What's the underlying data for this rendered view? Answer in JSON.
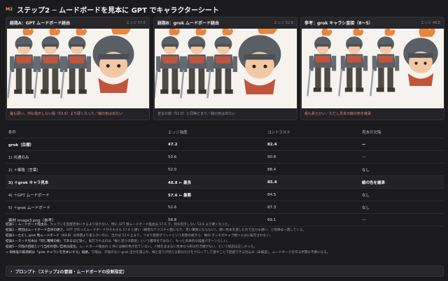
{
  "header": {
    "badge": "M2",
    "title": "ステップ2 ─ ムードボードを見本に GPT でキャラクターシート"
  },
  "colors": {
    "warn": "#e58b7a",
    "neutral": "#9a9aa2",
    "accent": "#e9a45c",
    "plume": "#e8863e",
    "armor": "#5a5f66"
  },
  "cards": [
    {
      "label": "経路A：GPT ムードボード経由",
      "score": "エッジ 57.6",
      "caption": "最も硬い。何も指示しない版（53.6）より硬くなった／線の色は出ない",
      "caption_color": "#e58b7a"
    },
    {
      "label": "経路B：grok ムードボード経由",
      "score": "エッジ 52.6",
      "caption": "宣言の値（52.0）と同等どまり／線の色は出ない",
      "caption_color": "#9a9aa2"
    },
    {
      "label": "参考：grok キャラシ直接（8〜5）",
      "score": "エッジ 48.8",
      "caption": "最も柔らかい／ただし見本の線の色を継承",
      "caption_color": "#e58b7a"
    }
  ],
  "table": {
    "headers": [
      "条件",
      "エッジ強度",
      "コントラスト",
      "見本の欠陥"
    ],
    "rows": [
      {
        "cells": [
          "grok（目標）",
          "47.2",
          "82.4",
          "—"
        ],
        "bold": true
      },
      {
        "cells": [
          "1) 共通のみ",
          "53.6",
          "90.8",
          "—"
        ],
        "bold": false
      },
      {
        "cells": [
          "2) ＋筆致（言葉）",
          "52.0",
          "88.4",
          "なし"
        ],
        "bold": false
      },
      {
        "cells": [
          "3) ＋grok キャラ見本",
          "48.8 ← 最良",
          "85.4",
          "線の色を継承"
        ],
        "bold": true
      },
      {
        "cells": [
          "4) ＋GPT ムードボード",
          "57.6 ← 最悪",
          "84.5",
          "なし"
        ],
        "bold": false
      },
      {
        "cells": [
          "5) ＋grok ムードボード",
          "52.6",
          "87.3",
          "なし"
        ],
        "bold": false
      },
      {
        "cells": [
          "素材 image3.png（参考）",
          "58.8",
          "69.1",
          "—"
        ],
        "bold": false
      }
    ]
  },
  "notes": [
    {
      "key": "結論1 ─ ムードボード経由は、",
      "text": "キャラシを直接見本にするより効かない。特に GPT 製ムードボード経由は 57.6 で、何も指示しない 53.6 より硬くなった。"
    },
    {
      "key": "結論2 ─ 原因はムードボード自体の硬さ。",
      "text": "GPT が作ったムードボードがそもそも 57.8 と硬い（線密なテクスチャ面になり、荒い筆致にならない）。硬い見本を渡したので出力も硬い、と因果は一貫している。"
    },
    {
      "key": "結論3 ─ ただし grok 製ムードボード（43.0）",
      "text": "は目標より柔らかいのに、出力は 52.6 止まり。つまり質感グリッドという形態の絵から、線の タッチがキャラ絵へ十分に転写されない。"
    },
    {
      "key": "結論4 ─ タッチ見本は「同じ種類の絵」であるほど効く。",
      "text": "転写されるのは「線と塗りの質感」という層単位ではなく、もっと具体的な描画パターンらしい。"
    },
    {
      "key": "結論5 ─ 欠陥の回避という当初の狙い自体は成功。",
      "text": "ムードボード経由の 2 件には線の色が出ていない。人物を含まない見本なら形は引き継がない、という仮説は正しかった。"
    },
    {
      "key": "→ 価格差の最適解は「grok キャラシを見本にする」経路。",
      "text": "欠陥は、欠陥のない grok 出力を選ぶか、線と塗りが見える部分だけをクロップして渡すことで回避できる見込み（未検証）。ムードボードを作る手間も不要になる。"
    }
  ],
  "prompt": {
    "arrow": "›",
    "label": "プロンプト（ステップ2の冒頭・ムードボードの役割指定）"
  }
}
